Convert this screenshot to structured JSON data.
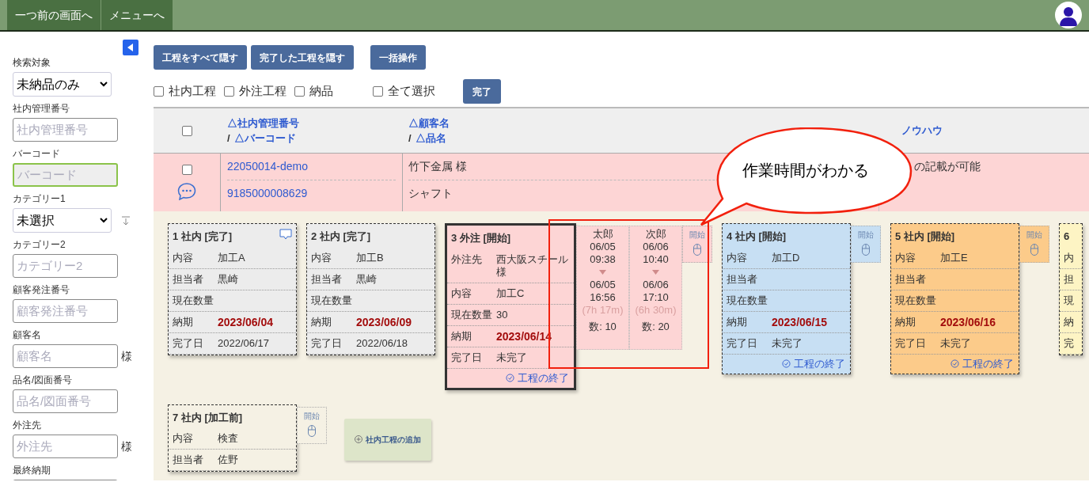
{
  "top_bar": {
    "buttons": [
      "一つ前の画面へ",
      "メニューへ"
    ]
  },
  "sidebar": {
    "fields": [
      {
        "label": "検索対象",
        "kind": "select",
        "value": "未納品のみ"
      },
      {
        "label": "社内管理番号",
        "kind": "input",
        "placeholder": "社内管理番号"
      },
      {
        "label": "バーコード",
        "kind": "input",
        "placeholder": "バーコード",
        "focused": true
      },
      {
        "label": "カテゴリー1",
        "kind": "select",
        "value": "未選択",
        "sort": true
      },
      {
        "label": "カテゴリー2",
        "kind": "input",
        "placeholder": "カテゴリー2"
      },
      {
        "label": "顧客発注番号",
        "kind": "input",
        "placeholder": "顧客発注番号"
      },
      {
        "label": "顧客名",
        "kind": "input",
        "placeholder": "顧客名",
        "suffix": "様"
      },
      {
        "label": "品名/図面番号",
        "kind": "input",
        "placeholder": "品名/図面番号"
      },
      {
        "label": "外注先",
        "kind": "input",
        "placeholder": "外注先",
        "suffix": "様"
      },
      {
        "label": "最終納期",
        "kind": "input"
      }
    ]
  },
  "toolbar": {
    "buttons": [
      "工程をすべて隠す",
      "完了した工程を隠す",
      "一括操作"
    ],
    "filters": [
      {
        "label": "社内工程",
        "checked": false
      },
      {
        "label": "外注工程",
        "checked": false
      },
      {
        "label": "納品",
        "checked": false
      }
    ],
    "select_all": {
      "label": "全て選択",
      "checked": false
    },
    "done_button": "完了"
  },
  "table": {
    "header": {
      "checked": false,
      "columns": [
        {
          "primary": "△社内管理番号",
          "separator": "/",
          "secondary": "△バーコード"
        },
        {
          "primary": "△顧客名",
          "separator": "/",
          "secondary": "△品名"
        },
        {
          "primary": "ノウハウ"
        }
      ]
    },
    "rows": [
      {
        "checked": false,
        "has_comment": true,
        "cells": [
          [
            "22050014-demo",
            "9185000008629"
          ],
          [
            "竹下金属 様",
            "シャフト"
          ],
          [
            "の記載が可能"
          ]
        ]
      }
    ]
  },
  "process_rows": [
    {
      "cards": [
        {
          "title": "1 社内 [完了]",
          "color": "#ececec",
          "selected": false,
          "has_comment": true,
          "fields": [
            {
              "label": "内容",
              "value": "加工A",
              "kind": "text"
            },
            {
              "label": "担当者",
              "value": "黒崎",
              "kind": "text"
            },
            {
              "label": "現在数量"
            },
            {
              "label": "納期",
              "value": "2023/06/04",
              "kind": "due"
            },
            {
              "label": "完了日",
              "value": "2022/06/17",
              "kind": "text"
            }
          ]
        },
        {
          "title": "2 社内 [完了]",
          "color": "#ececec",
          "selected": false,
          "fields": [
            {
              "label": "内容",
              "value": "加工B",
              "kind": "text"
            },
            {
              "label": "担当者",
              "value": "黒崎",
              "kind": "text"
            },
            {
              "label": "現在数量"
            },
            {
              "label": "納期",
              "value": "2023/06/09",
              "kind": "due"
            },
            {
              "label": "完了日",
              "value": "2022/06/18",
              "kind": "text"
            }
          ]
        },
        {
          "title": "3 外注 [開始]",
          "color": "#fdd5d5",
          "selected": true,
          "fields": [
            {
              "label": "外注先",
              "value": "西大阪スチール様",
              "kind": "text"
            },
            {
              "label": "内容",
              "value": "加工C",
              "kind": "text"
            },
            {
              "label": "現在数量",
              "value": "30",
              "kind": "text"
            },
            {
              "label": "納期",
              "value": "2023/06/14",
              "kind": "due"
            },
            {
              "label": "完了日",
              "value": "未完了",
              "kind": "text"
            }
          ],
          "end_link": "工程の終了",
          "logs": [
            {
              "worker": "太郎",
              "start_date": "06/05",
              "start_time": "09:38",
              "end_date": "06/05",
              "end_time": "16:56",
              "duration": "(7h 17m)",
              "quantity": "数: 10"
            },
            {
              "worker": "次郎",
              "start_date": "06/06",
              "start_time": "10:40",
              "end_date": "06/06",
              "end_time": "17:10",
              "duration": "(6h 30m)",
              "quantity": "数: 20"
            }
          ],
          "start": "開始"
        },
        {
          "title": "4 社内 [開始]",
          "color": "#c7dff3",
          "selected": false,
          "fields": [
            {
              "label": "内容",
              "value": "加工D",
              "kind": "text"
            },
            {
              "label": "担当者"
            },
            {
              "label": "現在数量"
            },
            {
              "label": "納期",
              "value": "2023/06/15",
              "kind": "due"
            },
            {
              "label": "完了日",
              "value": "未完了",
              "kind": "text"
            }
          ],
          "end_link": "工程の終了",
          "start": "開始"
        },
        {
          "title": "5 社内 [開始]",
          "color": "#fccb8a",
          "selected": false,
          "fields": [
            {
              "label": "内容",
              "value": "加工E",
              "kind": "text"
            },
            {
              "label": "担当者"
            },
            {
              "label": "現在数量"
            },
            {
              "label": "納期",
              "value": "2023/06/16",
              "kind": "due"
            },
            {
              "label": "完了日",
              "value": "未完了",
              "kind": "text"
            }
          ],
          "end_link": "工程の終了",
          "start": "開始"
        },
        {
          "title": "6",
          "color": "#fdf4c4",
          "selected": false,
          "fields": [
            {
              "label": "内"
            },
            {
              "label": "担"
            },
            {
              "label": "現"
            },
            {
              "label": "納"
            },
            {
              "label": "完"
            }
          ]
        }
      ]
    },
    {
      "cards": [
        {
          "title": "7 社内 [加工前]",
          "color": "#f5f1e4",
          "selected": false,
          "fields": [
            {
              "label": "内容",
              "value": "検査",
              "kind": "text"
            },
            {
              "label": "担当者",
              "value": "佐野",
              "kind": "text"
            }
          ],
          "start": "開始"
        }
      ],
      "add_button": "社内工程の追加"
    }
  ],
  "annotation": {
    "text": "作業時間がわかる"
  }
}
